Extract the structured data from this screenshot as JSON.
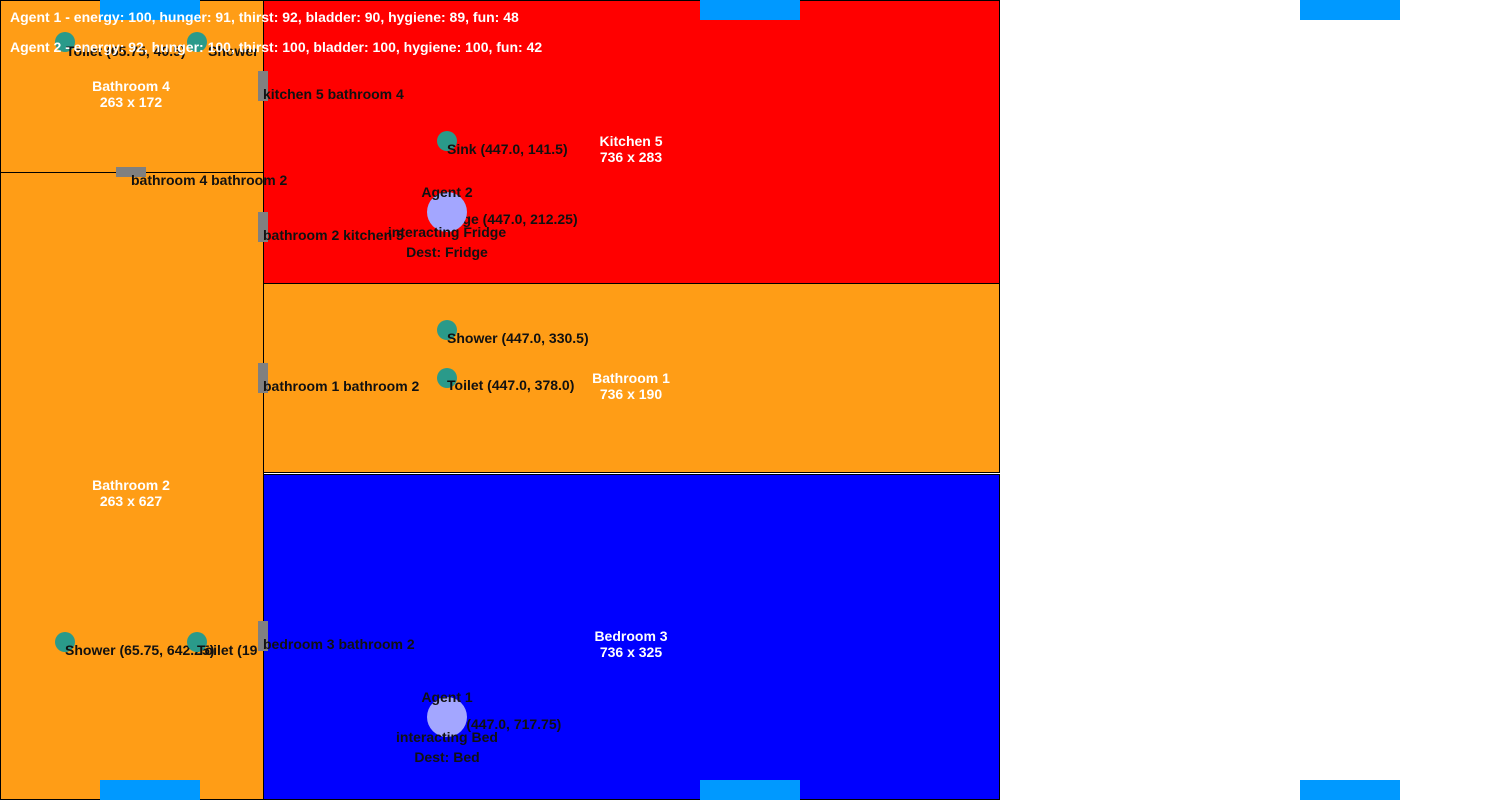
{
  "colors": {
    "kitchen": "#ff0000",
    "bathroom": "#ff9d16",
    "bedroom": "#0000ff",
    "marker": "#0099ff",
    "door": "#808080",
    "object": "#2a9a8a",
    "agent": "#a3a6ff"
  },
  "status": {
    "agent1": "Agent 1 - energy: 100, hunger: 91, thirst: 92, bladder: 90, hygiene: 89, fun: 48",
    "agent2": "Agent 2 - energy: 92, hunger: 100, thirst: 100, bladder: 100, hygiene: 100, fun: 42"
  },
  "rooms": {
    "bathroom4": {
      "name": "Bathroom 4",
      "size": "263 x 172"
    },
    "bathroom2": {
      "name": "Bathroom 2",
      "size": "263 x 627"
    },
    "kitchen5": {
      "name": "Kitchen 5",
      "size": "736 x 283"
    },
    "bathroom1": {
      "name": "Bathroom 1",
      "size": "736 x 190"
    },
    "bedroom3": {
      "name": "Bedroom 3",
      "size": "736 x 325"
    }
  },
  "doors": {
    "kitchen5_bathroom4": "kitchen 5 bathroom 4",
    "bathroom4_bathroom2": "bathroom 4 bathroom 2",
    "bathroom2_kitchen5": "bathroom 2 kitchen 5",
    "bathroom1_bathroom2": "bathroom 1 bathroom 2",
    "bedroom3_bathroom2": "bedroom 3 bathroom 2"
  },
  "objects": {
    "toilet_b4": "Toilet (65.75, 40.5)",
    "shower_b4": "Shower",
    "sink_k5": "Sink (447.0, 141.5)",
    "fridge_k5": "Fridge (447.0, 212.25)",
    "shower_b1": "Shower (447.0, 330.5)",
    "toilet_b1": "Toilet (447.0, 378.0)",
    "shower_b2": "Shower (65.75, 642.25)",
    "toilet_b2": "Toilet (19",
    "bed_b3": "Bed (447.0, 717.75)"
  },
  "agents": {
    "agent2": {
      "name": "Agent 2",
      "action": "interacting Fridge",
      "dest": "Dest: Fridge"
    },
    "agent1": {
      "name": "Agent 1",
      "action": "interacting Bed",
      "dest": "Dest: Bed"
    }
  }
}
